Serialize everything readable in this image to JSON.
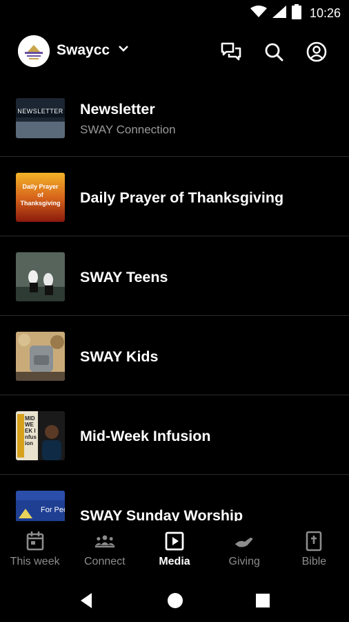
{
  "status_bar": {
    "time": "10:26"
  },
  "header": {
    "church_name": "Swaycc"
  },
  "media_items": [
    {
      "title": "Newsletter",
      "subtitle": "SWAY Connection",
      "thumb_text": "NEWSLETTER"
    },
    {
      "title": "Daily Prayer of Thanksgiving",
      "subtitle": "",
      "thumb_text": "Daily Prayer of Thanksgiving"
    },
    {
      "title": "SWAY Teens",
      "subtitle": ""
    },
    {
      "title": "SWAY Kids",
      "subtitle": ""
    },
    {
      "title": "Mid-Week Infusion",
      "subtitle": "",
      "thumb_text": "MIDWEEK Infusion"
    },
    {
      "title": "SWAY Sunday Worship",
      "subtitle": "",
      "thumb_text": "For Peo"
    }
  ],
  "bottom_nav": [
    {
      "label": "This week",
      "icon": "calendar-icon"
    },
    {
      "label": "Connect",
      "icon": "people-icon"
    },
    {
      "label": "Media",
      "icon": "play-icon",
      "active": true
    },
    {
      "label": "Giving",
      "icon": "hand-icon"
    },
    {
      "label": "Bible",
      "icon": "bible-icon"
    }
  ],
  "colors": {
    "background": "#000000",
    "active": "#ffffff",
    "inactive": "#8c8c8c",
    "divider": "#2a2a2a"
  }
}
